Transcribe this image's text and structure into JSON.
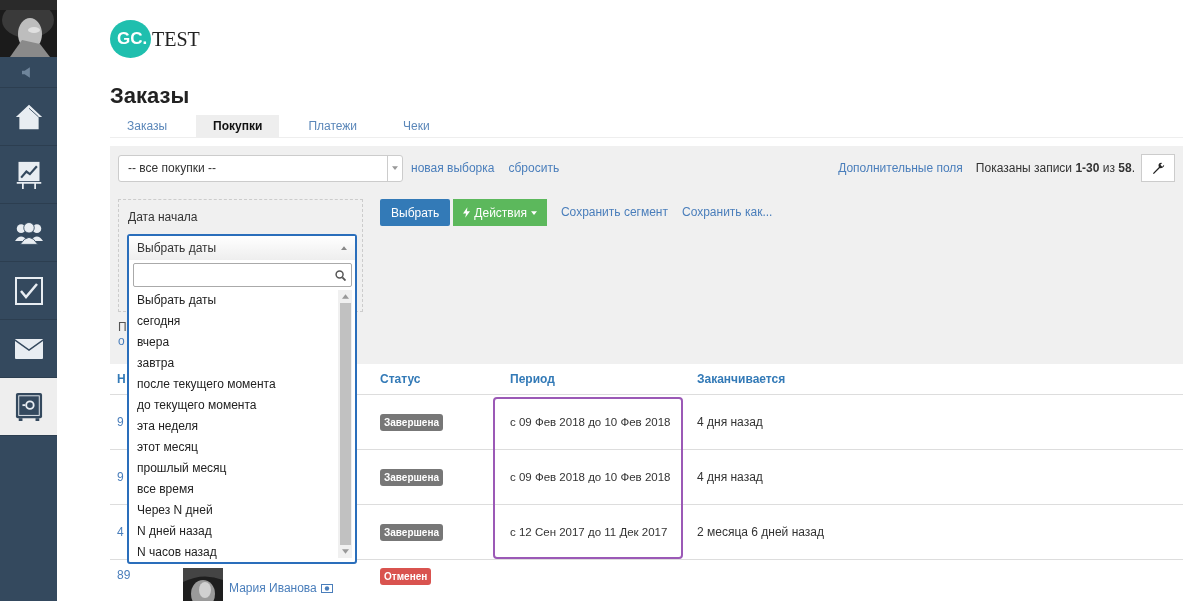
{
  "sidebar": {
    "items": [
      {
        "kind": "sound",
        "selected": false
      },
      {
        "kind": "home",
        "selected": false
      },
      {
        "kind": "chart",
        "selected": false
      },
      {
        "kind": "people",
        "selected": false
      },
      {
        "kind": "check",
        "selected": false
      },
      {
        "kind": "mail",
        "selected": false
      },
      {
        "kind": "safe",
        "selected": true
      }
    ]
  },
  "logo": {
    "badge": "GC.",
    "text": "TEST"
  },
  "page_title": "Заказы",
  "tabs": [
    {
      "label": "Заказы",
      "selected": false
    },
    {
      "label": "Покупки",
      "selected": true
    },
    {
      "label": "Платежи",
      "selected": false
    },
    {
      "label": "Чеки",
      "selected": false
    }
  ],
  "filter": {
    "segment_select": {
      "value": "-- все покупки --"
    },
    "links": [
      "новая выборка",
      "сбросить"
    ],
    "extra_fields_link": "Дополнительные поля",
    "records_info": "Показаны записи **1-30** из **58**.",
    "date_filter": {
      "label": "Дата начала"
    },
    "select_button": "Выбрать",
    "actions_button": "Действия",
    "save_links": [
      "Сохранить сегмент",
      "Сохранить как..."
    ],
    "cut_lines": [
      "П",
      "о"
    ]
  },
  "date_dropdown": {
    "value": "Выбрать даты",
    "options": [
      "Выбрать даты",
      "сегодня",
      "вчера",
      "завтра",
      "после текущего момента",
      "до текущего момента",
      "эта неделя",
      "этот месяц",
      "прошлый месяц",
      "все время",
      "Через N дней",
      "N дней назад",
      "N часов назад"
    ]
  },
  "table": {
    "columns": [
      "Н",
      "Статус",
      "Период",
      "Заканчивается"
    ],
    "rows": [
      {
        "id": "9",
        "status": "Завершена",
        "color": "#777777",
        "period": "с 09 Фев 2018 до 10 Фев 2018",
        "ends": "4 дня назад"
      },
      {
        "id": "9",
        "status": "Завершена",
        "color": "#777777",
        "period": "с 09 Фев 2018 до 10 Фев 2018",
        "ends": "4 дня назад"
      },
      {
        "id": "4",
        "status": "Завершена",
        "color": "#777777",
        "period": "с 12 Сен 2017 до 11 Дек 2017",
        "ends": "2 месяца 6 дней назад"
      },
      {
        "id": "89",
        "user": "Мария Иванова",
        "status": "Отменен",
        "color": "#d9534f"
      }
    ]
  }
}
